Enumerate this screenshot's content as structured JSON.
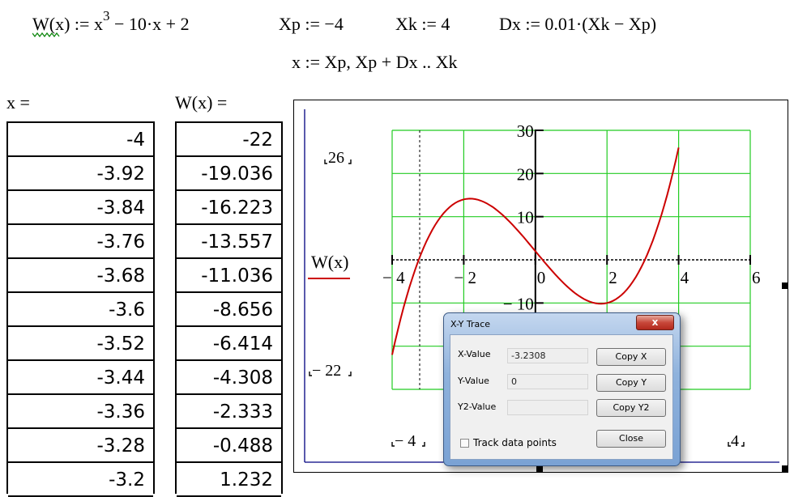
{
  "definitions": {
    "function_def_lhs": "W(x)",
    "function_def_assign": ":=",
    "function_def_rhs_base": "x",
    "function_def_rhs_exp": "3",
    "function_def_rhs_rest": "−  10·x + 2",
    "xp_def": "Xp :=  −4",
    "xk_def": "Xk :=  4",
    "dx_def": "Dx :=  0.01·(Xk −  Xp)",
    "range_def": "x :=  Xp, Xp + Dx .. Xk"
  },
  "tables": {
    "x_label": "x  =",
    "w_label": "W(x)  =",
    "x_values": [
      "-4",
      "-3.92",
      "-3.84",
      "-3.76",
      "-3.68",
      "-3.6",
      "-3.52",
      "-3.44",
      "-3.36",
      "-3.28",
      "-3.2"
    ],
    "w_values": [
      "-22",
      "-19.036",
      "-16.223",
      "-13.557",
      "-11.036",
      "-8.656",
      "-6.414",
      "-4.308",
      "-2.333",
      "-0.488",
      "1.232"
    ]
  },
  "plot": {
    "legend_label": "W(x)",
    "ymax_marker": "26",
    "ymin_marker": "− 22",
    "xmin_marker": "− 4",
    "xmax_marker": "4",
    "curve_color": "#cc0000",
    "grid_color": "#22cc22",
    "frame_color": "#000080"
  },
  "chart_data": {
    "type": "line",
    "title": "",
    "xlabel": "",
    "ylabel": "W(x)",
    "function": "x^3 - 10*x + 2",
    "x_range": [
      -4,
      4
    ],
    "x_step": 0.08,
    "xlim": [
      -4,
      6
    ],
    "ylim": [
      -30,
      30
    ],
    "x_ticks": [
      "− 4",
      "− 2",
      "0",
      "2",
      "4",
      "6"
    ],
    "x_tick_values": [
      -4,
      -2,
      0,
      2,
      4,
      6
    ],
    "y_ticks": [
      "30",
      "20",
      "10",
      "− 10"
    ],
    "y_tick_values": [
      30,
      20,
      10,
      -10
    ],
    "grid": true,
    "trace_x": -3.2308,
    "series": [
      {
        "name": "W(x)",
        "color": "#cc0000"
      }
    ]
  },
  "trace_dialog": {
    "title": "X-Y Trace",
    "close_glyph": "x",
    "x_label": "X-Value",
    "x_value": "-3.2308",
    "y_label": "Y-Value",
    "y_value": "0",
    "y2_label": "Y2-Value",
    "y2_value": "",
    "copy_x": "Copy X",
    "copy_y": "Copy Y",
    "copy_y2": "Copy Y2",
    "close": "Close",
    "track_label": "Track data points",
    "track_checked": false
  }
}
